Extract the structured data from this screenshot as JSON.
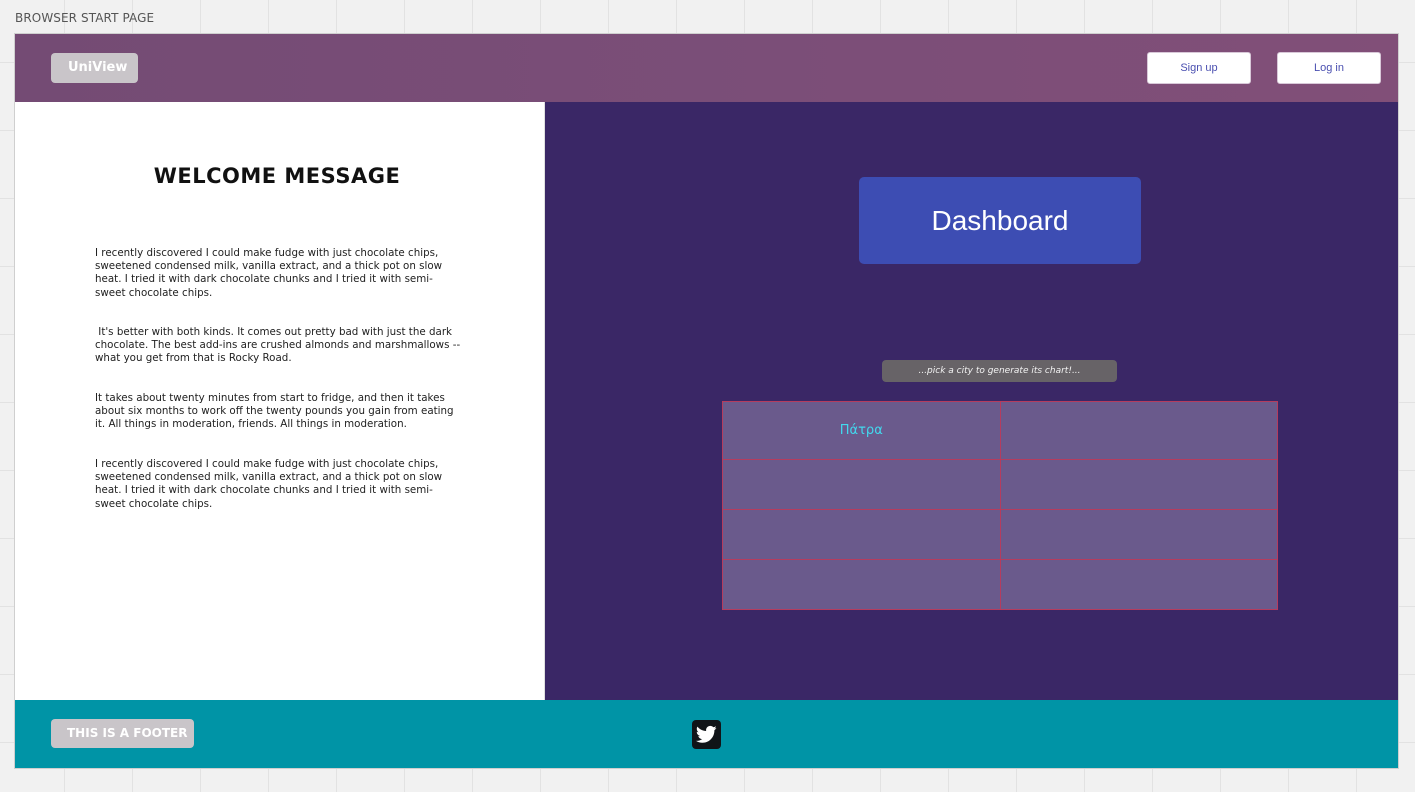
{
  "frame": {
    "label": "BROWSER START PAGE"
  },
  "header": {
    "logo": "UniView",
    "signup_label": "Sign up",
    "login_label": "Log in"
  },
  "welcome": {
    "title": "WELCOME MESSAGE",
    "paragraphs": [
      "I recently discovered I could make fudge with just chocolate chips, sweetened condensed milk, vanilla extract, and a thick pot on slow heat. I tried it with dark chocolate chunks and I tried it with semi-sweet chocolate chips.",
      " It's better with both kinds. It comes out pretty bad with just the dark chocolate. The best add-ins are crushed almonds and marshmallows -- what you get from that is Rocky Road.",
      "It takes about twenty minutes from start to fridge, and then it takes about six months to work off the twenty pounds you gain from eating it. All things in moderation, friends. All things in moderation.",
      "I recently discovered I could make fudge with just chocolate chips, sweetened condensed milk, vanilla extract, and a thick pot on slow heat. I tried it with dark chocolate chunks and I tried it with semi-sweet chocolate chips."
    ]
  },
  "dashboard": {
    "button_label": "Dashboard",
    "hint": "...pick a city to generate its chart!...",
    "table": [
      [
        "Πάτρα",
        ""
      ],
      [
        "",
        ""
      ],
      [
        "",
        ""
      ],
      [
        "",
        ""
      ]
    ]
  },
  "footer": {
    "label": "THIS IS A FOOTER",
    "social_icon": "twitter-icon"
  },
  "colors": {
    "header": "#7b4e78",
    "dashboard_bg": "#3a2766",
    "dashboard_button": "#3d4db3",
    "table_cell": "#6a5a8c",
    "table_border": "#b53c5e",
    "city_text": "#42d9ee",
    "footer": "#0094a6"
  }
}
